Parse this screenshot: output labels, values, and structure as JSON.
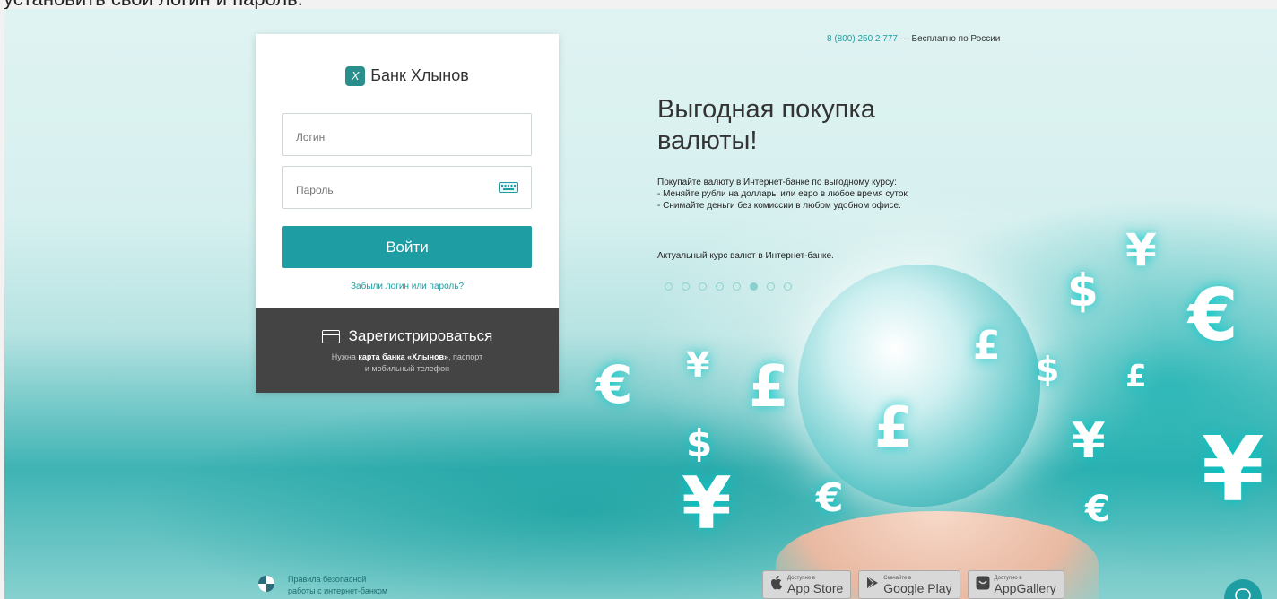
{
  "caption": "установить свой логин и пароль.",
  "header": {
    "phone": "8 (800) 250 2 777",
    "phone_note": " — Бесплатно по России"
  },
  "login": {
    "bank_name": "Банк Хлынов",
    "login_placeholder": "Логин",
    "password_placeholder": "Пароль",
    "submit_label": "Войти",
    "forgot_link": "Забыли логин или пароль?"
  },
  "register": {
    "label": "Зарегистрироваться",
    "note_prefix": "Нужна ",
    "note_card": "карта банка «Хлынов»",
    "note_suffix": ", паспорт",
    "note_line2": "и мобильный телефон"
  },
  "promo": {
    "title_line1": "Выгодная покупка",
    "title_line2": "валюты!",
    "body_line1": "Покупайте валюту в Интернет-банке по выгодному курсу:",
    "body_line2": "- Меняйте рубли на доллары или евро в любое время суток",
    "body_line3": "- Снимайте деньги без комиссии в любом удобном офисе.",
    "rate_note": "Актуальный курс валют в Интернет-банке.",
    "slides_total": 8,
    "active_slide": 6
  },
  "footer": {
    "safety_line1": "Правила безопасной",
    "safety_line2": "работы с интернет-банком",
    "stores": [
      {
        "small": "Доступно в",
        "name": "App Store",
        "icon": "apple-icon"
      },
      {
        "small": "Скачайте в",
        "name": "Google Play",
        "icon": "google-play-icon"
      },
      {
        "small": "Доступно в",
        "name": "AppGallery",
        "icon": "appgallery-icon"
      }
    ]
  },
  "colors": {
    "accent": "#1e9ea2",
    "register_bg": "#444444",
    "text": "#333333"
  }
}
